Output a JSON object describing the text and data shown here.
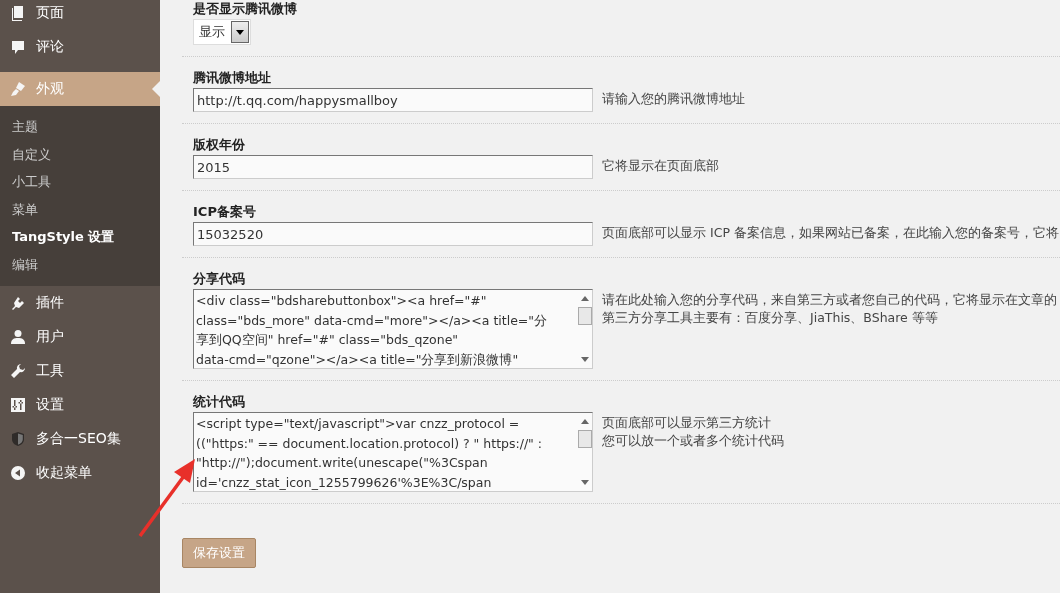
{
  "sidebar": {
    "items": [
      {
        "kind": "page",
        "label": "页面",
        "selected": false
      },
      {
        "kind": "comment",
        "label": "评论",
        "selected": false
      },
      {
        "kind": "brush",
        "label": "外观",
        "selected": true,
        "children": [
          {
            "label": "主题",
            "selected": false
          },
          {
            "label": "自定义",
            "selected": false
          },
          {
            "label": "小工具",
            "selected": false
          },
          {
            "label": "菜单",
            "selected": false
          },
          {
            "label": "TangStyle 设置",
            "selected": true
          },
          {
            "label": "编辑",
            "selected": false
          }
        ]
      },
      {
        "kind": "plugin",
        "label": "插件",
        "selected": false
      },
      {
        "kind": "user",
        "label": "用户",
        "selected": false
      },
      {
        "kind": "wrench",
        "label": "工具",
        "selected": false
      },
      {
        "kind": "settings",
        "label": "设置",
        "selected": false
      },
      {
        "kind": "shield",
        "label": "多合一SEO集",
        "selected": false
      },
      {
        "kind": "collapse",
        "label": "收起菜单",
        "selected": false
      }
    ]
  },
  "form": {
    "fields": [
      {
        "kind": "select",
        "label": "是否显示腾讯微博",
        "value": "显示"
      },
      {
        "kind": "text",
        "label": "腾讯微博地址",
        "value": "http://t.qq.com/happysmallboy",
        "description": [
          "请输入您的腾讯微博地址"
        ]
      },
      {
        "kind": "text",
        "label": "版权年份",
        "value": "2015",
        "description": [
          "它将显示在页面底部"
        ]
      },
      {
        "kind": "text",
        "label": "ICP备案号",
        "value": "15032520",
        "description": [
          "页面底部可以显示 ICP 备案信息，如果网站已备案，在此输入您的备案号，它将"
        ]
      },
      {
        "kind": "textarea",
        "label": "分享代码",
        "lines": [
          "<div class=\"bdsharebuttonbox\"><a href=\"#\"",
          "class=\"bds_more\" data-cmd=\"more\"></a><a title=\"分",
          "享到QQ空间\" href=\"#\" class=\"bds_qzone\"",
          "data-cmd=\"qzone\"></a><a title=\"分享到新浪微博\""
        ],
        "description": [
          "请在此处输入您的分享代码，来自第三方或者您自己的代码，它将显示在文章的",
          "第三方分享工具主要有：百度分享、JiaThis、BShare 等等"
        ]
      },
      {
        "kind": "textarea",
        "label": "统计代码",
        "lines": [
          "<script type=\"text/javascript\">var cnzz_protocol =",
          "((\"https:\" == document.location.protocol) ? \" https://\" :",
          "\"http://\");document.write(unescape(\"%3Cspan",
          "id='cnzz_stat_icon_1255799626'%3E%3C/span"
        ],
        "description": [
          "页面底部可以显示第三方统计",
          "您可以放一个或者多个统计代码"
        ]
      }
    ]
  },
  "save_button": {
    "label": "保存设置"
  },
  "annotations": [
    {
      "kind": "arrow"
    }
  ]
}
